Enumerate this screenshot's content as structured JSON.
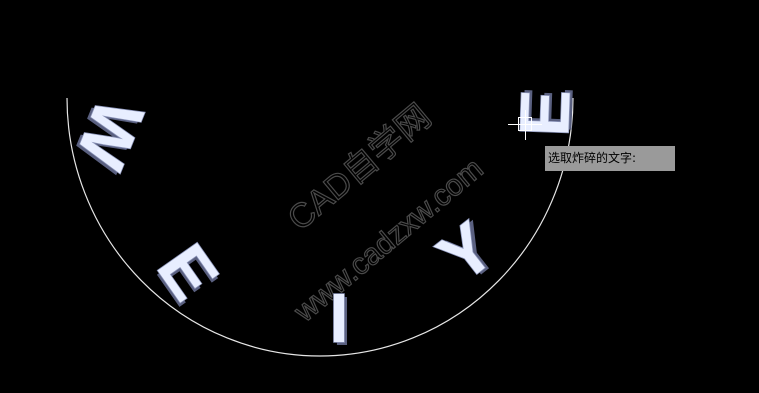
{
  "canvas": {
    "background": "#000000",
    "arc_color": "#e6e6e6",
    "letter_color": "#e8eeff"
  },
  "arc_letters": [
    "W",
    "E",
    "I",
    "Y",
    "E"
  ],
  "watermark": {
    "line1": "CAD自学网",
    "line2": "www.cadzxw.com"
  },
  "prompt": {
    "text": "选取炸碎的文字:"
  },
  "cursor": {
    "icon": "crosshair-pickbox-icon"
  }
}
